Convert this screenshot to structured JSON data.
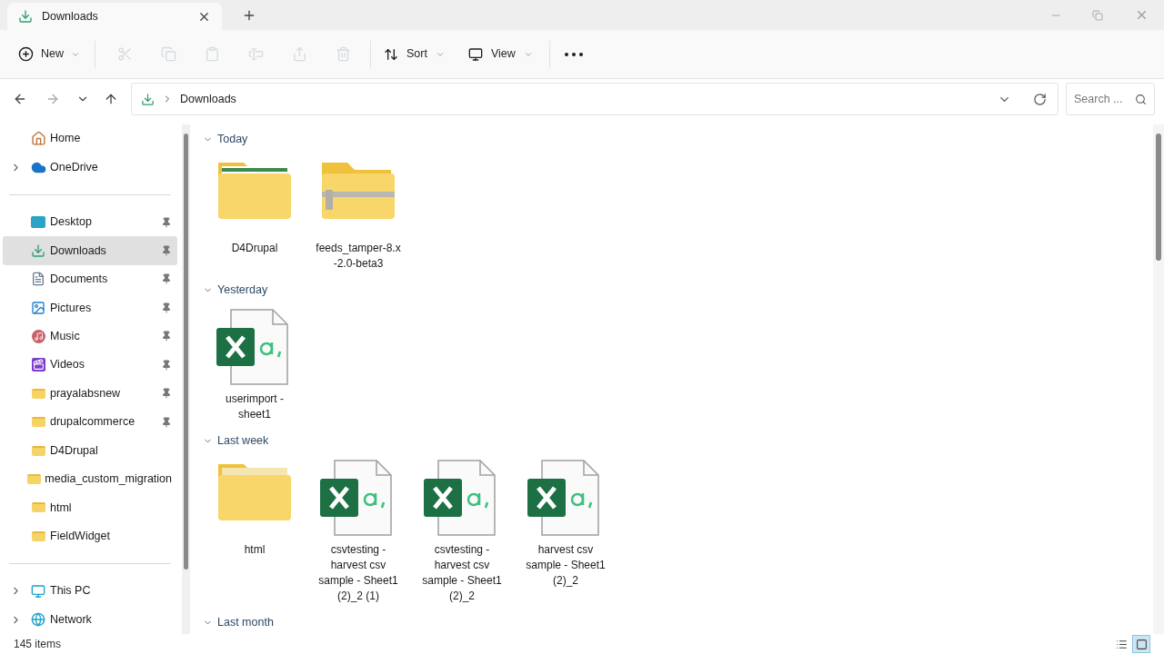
{
  "window": {
    "tab": {
      "title": "Downloads",
      "selected": true
    }
  },
  "toolbar": [
    {
      "kind": "new",
      "label": "New",
      "disabled": false
    },
    {
      "kind": "cut",
      "disabled": true
    },
    {
      "kind": "copy",
      "disabled": true
    },
    {
      "kind": "paste",
      "disabled": true
    },
    {
      "kind": "rename",
      "disabled": true
    },
    {
      "kind": "share",
      "disabled": true
    },
    {
      "kind": "delete",
      "disabled": true
    },
    {
      "kind": "sort",
      "label": "Sort",
      "disabled": false
    },
    {
      "kind": "view",
      "label": "View",
      "disabled": false
    },
    {
      "kind": "more",
      "disabled": false
    }
  ],
  "address": {
    "path": [
      "Downloads"
    ],
    "search_placeholder": "Search ..."
  },
  "sidebar": {
    "top": [
      {
        "label": "Home",
        "kind": "home",
        "expandable": false,
        "pinned": false,
        "selected": false
      },
      {
        "label": "OneDrive",
        "kind": "cloud",
        "expandable": true,
        "pinned": false,
        "selected": false
      }
    ],
    "quick_access": [
      {
        "label": "Desktop",
        "kind": "desktop",
        "expandable": false,
        "pinned": true,
        "selected": false
      },
      {
        "label": "Downloads",
        "kind": "download",
        "expandable": false,
        "pinned": true,
        "selected": true
      },
      {
        "label": "Documents",
        "kind": "documents",
        "expandable": false,
        "pinned": true,
        "selected": false
      },
      {
        "label": "Pictures",
        "kind": "pictures",
        "expandable": false,
        "pinned": true,
        "selected": false
      },
      {
        "label": "Music",
        "kind": "music",
        "expandable": false,
        "pinned": true,
        "selected": false
      },
      {
        "label": "Videos",
        "kind": "videos",
        "expandable": false,
        "pinned": true,
        "selected": false
      },
      {
        "label": "prayalabsnew",
        "kind": "folder",
        "expandable": false,
        "pinned": true,
        "selected": false
      },
      {
        "label": "drupalcommerce",
        "kind": "folder",
        "expandable": false,
        "pinned": true,
        "selected": false
      },
      {
        "label": "D4Drupal",
        "kind": "folder",
        "expandable": false,
        "pinned": false,
        "selected": false
      },
      {
        "label": "media_custom_migration",
        "kind": "folder",
        "expandable": false,
        "pinned": false,
        "selected": false
      },
      {
        "label": "html",
        "kind": "folder",
        "expandable": false,
        "pinned": false,
        "selected": false
      },
      {
        "label": "FieldWidget",
        "kind": "folder",
        "expandable": false,
        "pinned": false,
        "selected": false
      }
    ],
    "bottom": [
      {
        "label": "This PC",
        "kind": "pc",
        "expandable": true,
        "pinned": false,
        "selected": false
      },
      {
        "label": "Network",
        "kind": "network",
        "expandable": true,
        "pinned": false,
        "selected": false
      }
    ]
  },
  "groups": [
    {
      "label": "Today",
      "expanded": true,
      "items": [
        {
          "name": "D4Drupal",
          "kind": "preview-folder"
        },
        {
          "name": "feeds_tamper-8.x\n-2.0-beta3",
          "kind": "zip"
        }
      ]
    },
    {
      "label": "Yesterday",
      "expanded": true,
      "items": [
        {
          "name": "userimport -\nsheet1",
          "kind": "csv"
        }
      ]
    },
    {
      "label": "Last week",
      "expanded": true,
      "items": [
        {
          "name": "html",
          "kind": "edge-folder"
        },
        {
          "name": "csvtesting -\nharvest csv\nsample - Sheet1\n(2)_2 (1)",
          "kind": "csv"
        },
        {
          "name": "csvtesting -\nharvest csv\nsample - Sheet1\n(2)_2",
          "kind": "csv"
        },
        {
          "name": "harvest csv\nsample - Sheet1\n(2)_2",
          "kind": "csv"
        }
      ]
    },
    {
      "label": "Last month",
      "expanded": true
    }
  ],
  "status_bar": {
    "count": "145 items",
    "views": [
      {
        "kind": "details",
        "selected": false
      },
      {
        "kind": "tiles",
        "selected": true
      }
    ]
  }
}
